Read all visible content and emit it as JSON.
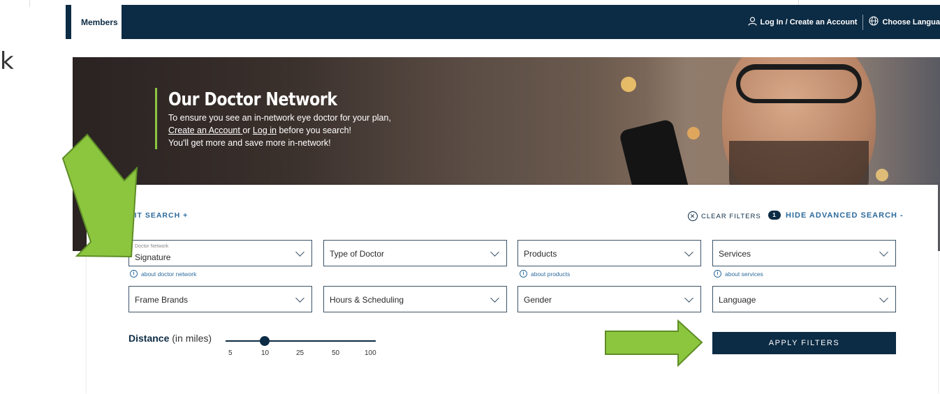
{
  "page": {
    "edge_char": "k"
  },
  "nav": {
    "members_label": "Members",
    "login_label": "Log In / Create an Account",
    "language_label": "Choose Langua"
  },
  "hero": {
    "title": "Our Doctor Network",
    "line1": "To ensure you see an in-network eye doctor for your plan,",
    "create_account": "Create an Account ",
    "or_text": " or ",
    "login": "Log in",
    "line2_rest": " before you search!",
    "line3": "You'll get more and save more in-network!"
  },
  "search": {
    "edit_search": "DIT SEARCH +",
    "clear_filters": "CLEAR FILTERS",
    "filter_count": "1",
    "hide_advanced": "HIDE ADVANCED SEARCH -",
    "doctor_network_label": "Doctor Network",
    "doctor_network_value": "Signature",
    "type_of_doctor": "Type of Doctor",
    "products": "Products",
    "services": "Services",
    "frame_brands": "Frame Brands",
    "hours_scheduling": "Hours & Scheduling",
    "gender": "Gender",
    "language": "Language",
    "about_network": "about doctor network",
    "about_products": "about products",
    "about_services": "about services",
    "distance_label": "Distance",
    "distance_unit": "(in miles)",
    "distance_ticks": [
      "5",
      "10",
      "25",
      "50",
      "100"
    ],
    "distance_selected": "10",
    "apply_label": "APPLY FILTERS"
  },
  "colors": {
    "navy": "#0c2b44",
    "accent_green": "#8cc63f",
    "link_blue": "#2d6a9b"
  }
}
